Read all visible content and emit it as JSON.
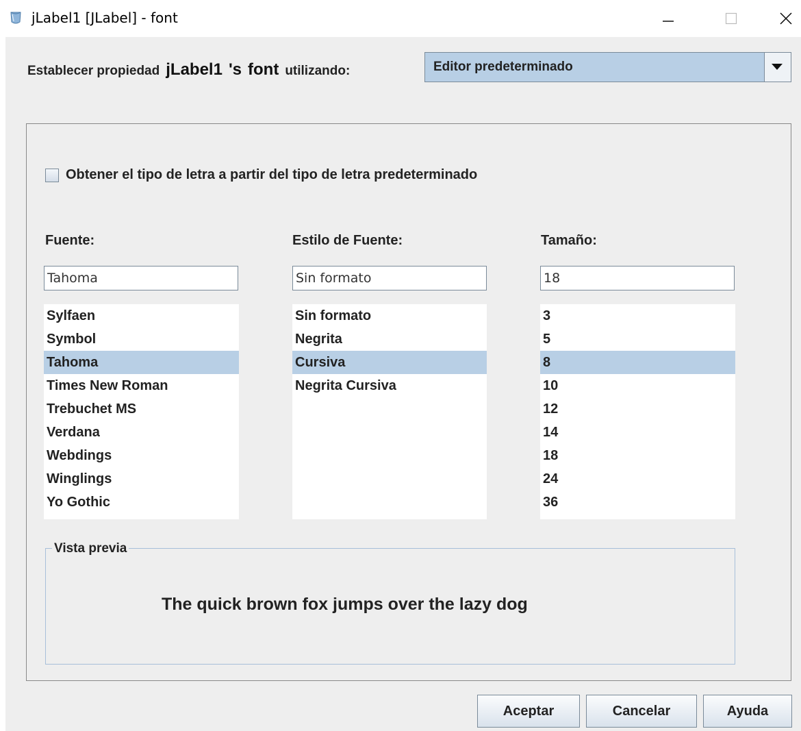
{
  "window": {
    "title": "jLabel1 [JLabel] - font",
    "icon": "java-cup-icon"
  },
  "header": {
    "prefix": "Establecer propiedad",
    "component": "jLabel1",
    "possessive": "'s",
    "property": "font",
    "suffix": "utilizando:",
    "editor_value": "Editor predeterminado"
  },
  "derive_checkbox": {
    "label": "Obtener el tipo de letra a partir del tipo de letra predeterminado",
    "checked": false
  },
  "font": {
    "label": "Fuente:",
    "value": "Tahoma",
    "items": [
      "Sylfaen",
      "Symbol",
      "Tahoma",
      "Times New Roman",
      "Trebuchet MS",
      "Verdana",
      "Webdings",
      "Winglings",
      "Yo Gothic"
    ],
    "selected": "Tahoma"
  },
  "style": {
    "label": "Estilo de Fuente:",
    "value": "Sin formato",
    "items": [
      "Sin formato",
      "Negrita",
      "Cursiva",
      "Negrita Cursiva"
    ],
    "selected": "Cursiva"
  },
  "size": {
    "label": "Tamaño:",
    "value": "18",
    "items": [
      "3",
      "5",
      "8",
      "10",
      "12",
      "14",
      "18",
      "24",
      "36"
    ],
    "selected": "8"
  },
  "preview": {
    "legend": "Vista previa",
    "text": "The quick brown fox jumps over the lazy dog"
  },
  "buttons": {
    "ok": "Aceptar",
    "cancel": "Cancelar",
    "help": "Ayuda"
  },
  "colors": {
    "selection": "#b8cfe5",
    "window_bg": "#eeeeee",
    "preview_border": "#a7bfd9"
  }
}
